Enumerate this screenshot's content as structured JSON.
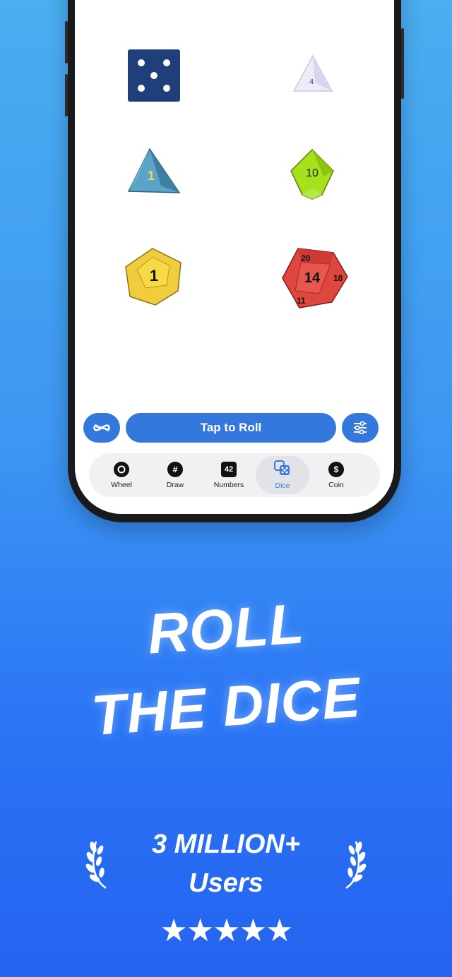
{
  "dice": {
    "d6": {
      "value": "5",
      "color": "#1e3f7a"
    },
    "d4_light": {
      "color": "#e6e6f6"
    },
    "d4_teal": {
      "value": "1",
      "color": "#4a8fb5"
    },
    "d10": {
      "value": "10",
      "color": "#8fd400"
    },
    "d12": {
      "value": "1",
      "color": "#f0cd3c"
    },
    "d20": {
      "value": "14",
      "top": "20",
      "left_val": "11",
      "right_val": "18",
      "color": "#e04640"
    }
  },
  "actions": {
    "infinite_icon": "infinity-icon",
    "roll_label": "Tap to Roll",
    "settings_icon": "sliders-icon"
  },
  "tabs": [
    {
      "label": "Wheel",
      "icon": "○"
    },
    {
      "label": "Draw",
      "icon": "#"
    },
    {
      "label": "Numbers",
      "icon": "42"
    },
    {
      "label": "Dice",
      "icon": "dice-icon"
    },
    {
      "label": "Coin",
      "icon": "$"
    }
  ],
  "headline": {
    "line1": "ROLL",
    "line2": "THE DICE"
  },
  "users": {
    "line1": "3 MILLION+",
    "line2": "Users"
  },
  "rating": {
    "stars": "★★★★★",
    "value": 5
  },
  "colors": {
    "accent": "#3478de",
    "bg_top": "#4aaef0",
    "bg_bottom": "#2563f0"
  }
}
